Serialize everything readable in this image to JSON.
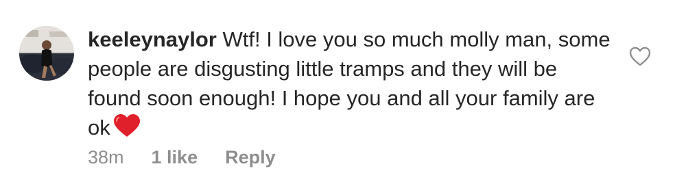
{
  "comment": {
    "username": "keeleynaylor",
    "text": "Wtf! I love you so much molly man, some people are disgusting little tramps and they will be found soon enough! I hope you and all your family are ok",
    "emoji": "red-heart",
    "time": "38m",
    "likes": "1 like",
    "reply_label": "Reply"
  },
  "icons": {
    "like": "heart-outline-icon",
    "emoji": "red-heart-emoji"
  },
  "colors": {
    "text": "#262626",
    "meta": "#8e8e8e",
    "heart_emoji": "#e0202b"
  }
}
